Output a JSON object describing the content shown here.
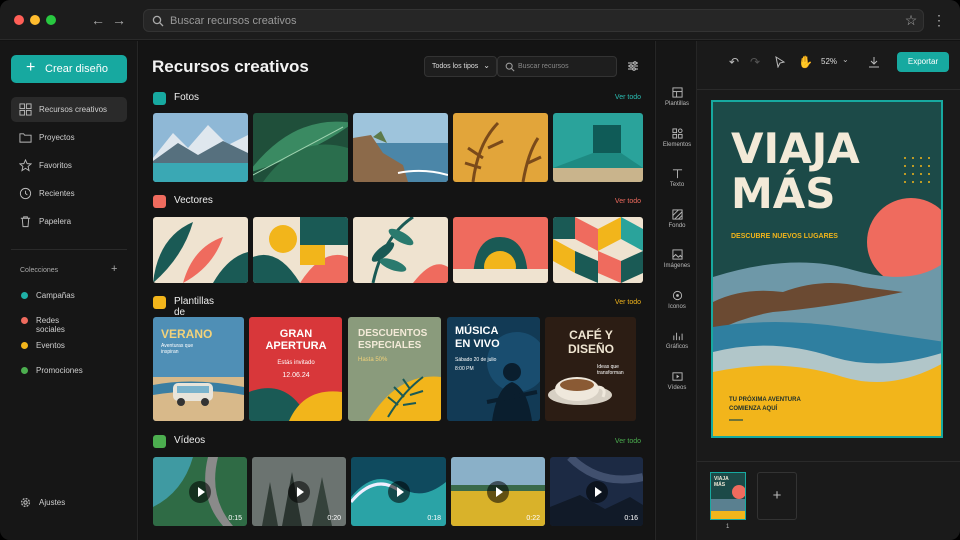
{
  "browser": {
    "search_placeholder": "Buscar recursos creativos"
  },
  "sidebar": {
    "create_label": "Crear diseño",
    "items": [
      {
        "label": "Recursos creativos",
        "icon": "grid-icon"
      },
      {
        "label": "Proyectos",
        "icon": "folder-icon"
      },
      {
        "label": "Favoritos",
        "icon": "star-icon"
      },
      {
        "label": "Recientes",
        "icon": "clock-icon"
      },
      {
        "label": "Papelera",
        "icon": "trash-icon"
      }
    ],
    "collections_title": "Colecciones",
    "collections": [
      {
        "label": "Campañas",
        "color": "#1fb0a6"
      },
      {
        "label": "Redes sociales",
        "color": "#ef6b5e"
      },
      {
        "label": "Eventos",
        "color": "#f2b51b"
      },
      {
        "label": "Promociones",
        "color": "#4cae4f"
      }
    ],
    "settings_label": "Ajustes"
  },
  "main": {
    "title": "Recursos creativos",
    "type_filter": "Todos los tipos",
    "search_placeholder": "Buscar recursos",
    "sections": [
      {
        "title": "Fotos",
        "see_all": "Ver todo",
        "color": "#17a9a0"
      },
      {
        "title": "Vectores",
        "color": "#ef6b5e",
        "see_all": "Ver todo"
      },
      {
        "title": "Plantillas de carteles",
        "color": "#f2b51b",
        "see_all": "Ver todo"
      },
      {
        "title": "Vídeos",
        "color": "#4cae4f",
        "see_all": "Ver todo"
      }
    ],
    "posters": [
      {
        "title": "VERANO",
        "sub": "Aventuras que inspiran"
      },
      {
        "title": "GRAN APERTURA",
        "sub": "Estás invitado",
        "date": "12.06.24"
      },
      {
        "title": "DESCUENTOS ESPECIALES",
        "sub": "Hasta 50%"
      },
      {
        "title": "MÚSICA EN VIVO",
        "sub": "Sábado 20 de julio",
        "time": "8:00 PM"
      },
      {
        "title": "CAFÉ Y DISEÑO",
        "sub": "Ideas que transforman"
      }
    ],
    "videos": [
      {
        "duration": "0:15"
      },
      {
        "duration": "0:20"
      },
      {
        "duration": "0:18"
      },
      {
        "duration": "0:22"
      },
      {
        "duration": "0:16"
      }
    ]
  },
  "rail": [
    {
      "label": "Plantillas",
      "icon": "template-icon"
    },
    {
      "label": "Elementos",
      "icon": "elements-icon"
    },
    {
      "label": "Texto",
      "icon": "text-icon"
    },
    {
      "label": "Fondo",
      "icon": "background-icon"
    },
    {
      "label": "Imágenes",
      "icon": "image-icon"
    },
    {
      "label": "Iconos",
      "icon": "icons-icon"
    },
    {
      "label": "Gráficos",
      "icon": "chart-icon"
    },
    {
      "label": "Vídeos",
      "icon": "video-icon"
    }
  ],
  "editor": {
    "zoom": "52%",
    "export_label": "Exportar",
    "poster": {
      "title": "VIAJA MÁS",
      "subtitle": "DESCUBRE NUEVOS LUGARES",
      "footer": "TU PRÓXIMA AVENTURA COMIENZA AQUÍ"
    },
    "page_number": "1",
    "thumb_title": "VIAJA MÁS"
  }
}
